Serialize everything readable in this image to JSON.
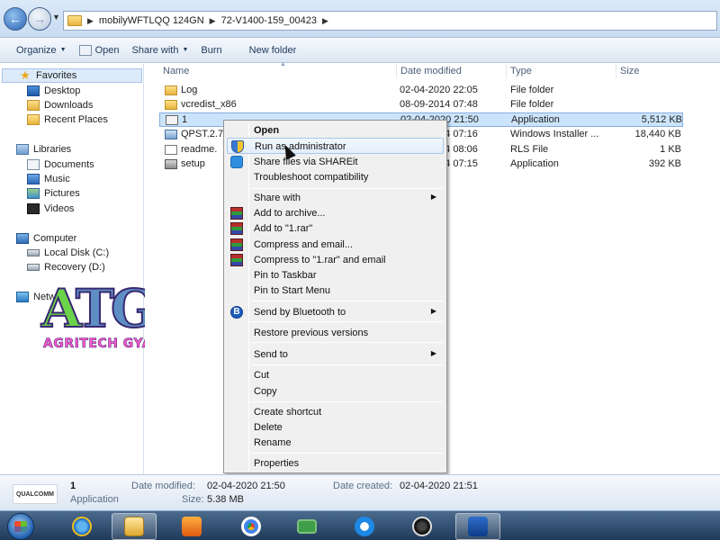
{
  "window": {
    "breadcrumb": [
      "mobilyWFTLQQ 124GN",
      "72-V1400-159_00423"
    ]
  },
  "toolbar": {
    "organize": "Organize",
    "open": "Open",
    "share_with": "Share with",
    "burn": "Burn",
    "new_folder": "New folder"
  },
  "nav": {
    "favorites": "Favorites",
    "desktop": "Desktop",
    "downloads": "Downloads",
    "recent_places": "Recent Places",
    "libraries": "Libraries",
    "documents": "Documents",
    "music": "Music",
    "pictures": "Pictures",
    "videos": "Videos",
    "computer": "Computer",
    "local_disk": "Local Disk (C:)",
    "recovery": "Recovery (D:)",
    "network": "Netw"
  },
  "watermark": {
    "letters_a": "A",
    "letters_tg": "TG",
    "text": "AGRITECH GYAN"
  },
  "columns": {
    "name": "Name",
    "date_modified": "Date modified",
    "type": "Type",
    "size": "Size"
  },
  "files": [
    {
      "name": "Log",
      "date": "02-04-2020 22:05",
      "type": "File folder",
      "size": ""
    },
    {
      "name": "vcredist_x86",
      "date": "08-09-2014 07:48",
      "type": "File folder",
      "size": ""
    },
    {
      "name": "1",
      "date": "02-04-2020 21:50",
      "type": "Application",
      "size": "5,512 KB"
    },
    {
      "name": "QPST.2.7",
      "date": "24-09-2014 07:16",
      "type": "Windows Installer ...",
      "size": "18,440 KB"
    },
    {
      "name": "readme.",
      "date": "24-09-2014 08:06",
      "type": "RLS File",
      "size": "1 KB"
    },
    {
      "name": "setup",
      "date": "24-09-2014 07:15",
      "type": "Application",
      "size": "392 KB"
    }
  ],
  "context_menu": {
    "open": "Open",
    "run_as_admin": "Run as administrator",
    "shareit": "Share files via SHAREit",
    "troubleshoot": "Troubleshoot compatibility",
    "share_with": "Share with",
    "add_to_archive": "Add to archive...",
    "add_to_rar": "Add to \"1.rar\"",
    "compress_email": "Compress and email...",
    "compress_rar_email": "Compress to \"1.rar\" and email",
    "pin_taskbar": "Pin to Taskbar",
    "pin_start": "Pin to Start Menu",
    "bluetooth": "Send by Bluetooth to",
    "restore": "Restore previous versions",
    "send_to": "Send to",
    "cut": "Cut",
    "copy": "Copy",
    "create_shortcut": "Create shortcut",
    "delete": "Delete",
    "rename": "Rename",
    "properties": "Properties"
  },
  "details": {
    "logo_text": "QUALCOMM",
    "file_name": "1",
    "file_type": "Application",
    "modified_label": "Date modified:",
    "modified_value": "02-04-2020 21:50",
    "size_label": "Size:",
    "size_value": "5.38 MB",
    "created_label": "Date created:",
    "created_value": "02-04-2020 21:51"
  }
}
